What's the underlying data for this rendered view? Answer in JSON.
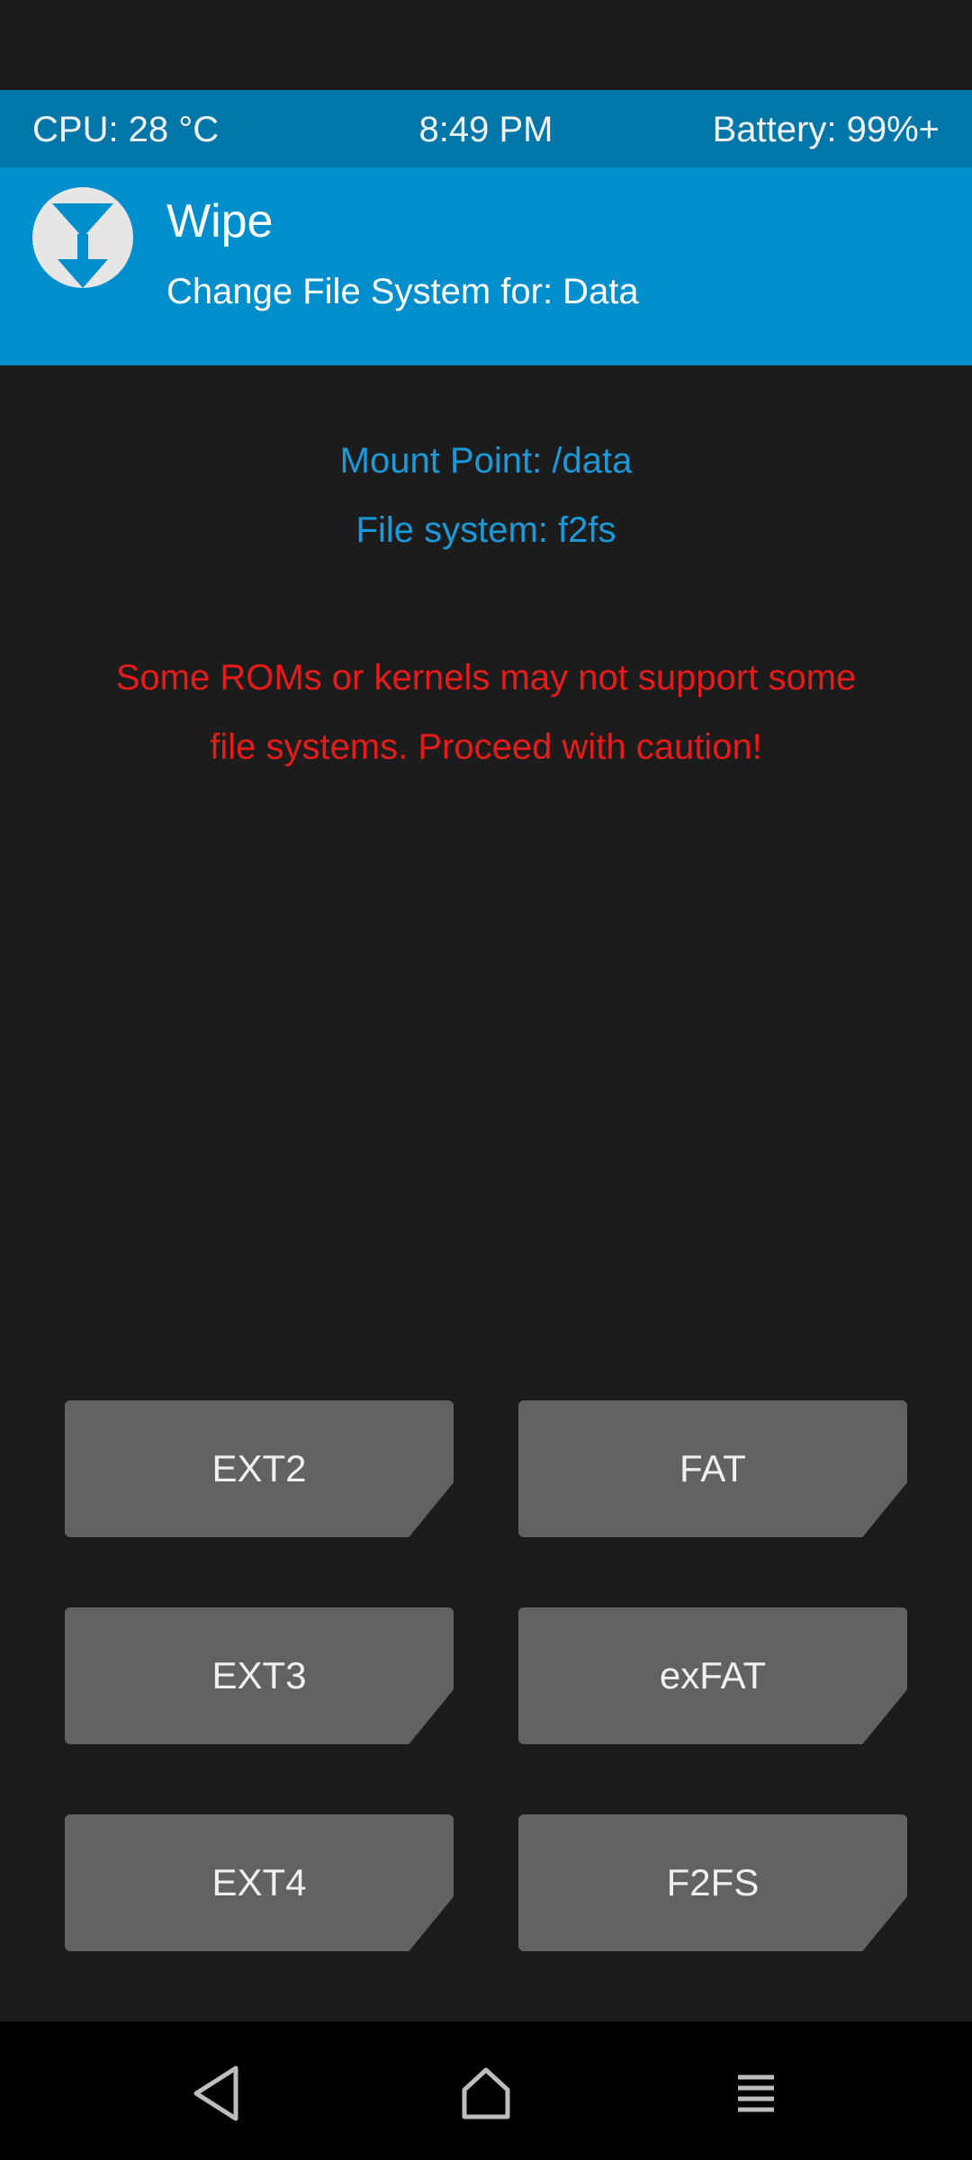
{
  "status": {
    "cpu": "CPU: 28 °C",
    "time": "8:49 PM",
    "battery": "Battery: 99%+"
  },
  "header": {
    "title": "Wipe",
    "subtitle": "Change File System for: Data",
    "logo_icon": "twrp-logo-icon"
  },
  "info": {
    "mount_point": "Mount Point: /data",
    "file_system": "File system: f2fs"
  },
  "warning": "Some ROMs or kernels may not support some file systems. Proceed with caution!",
  "buttons": {
    "ext2": "EXT2",
    "fat": "FAT",
    "ext3": "EXT3",
    "exfat": "exFAT",
    "ext4": "EXT4",
    "f2fs": "F2FS"
  },
  "navbar": {
    "icons": [
      "back-icon",
      "home-icon",
      "menu-icon"
    ]
  },
  "colors": {
    "status_bar": "#0077a8",
    "header": "#008fcc",
    "background": "#1c1c1c",
    "info_text": "#1b9ad9",
    "warning_text": "#e81b1b",
    "button": "#626262"
  }
}
